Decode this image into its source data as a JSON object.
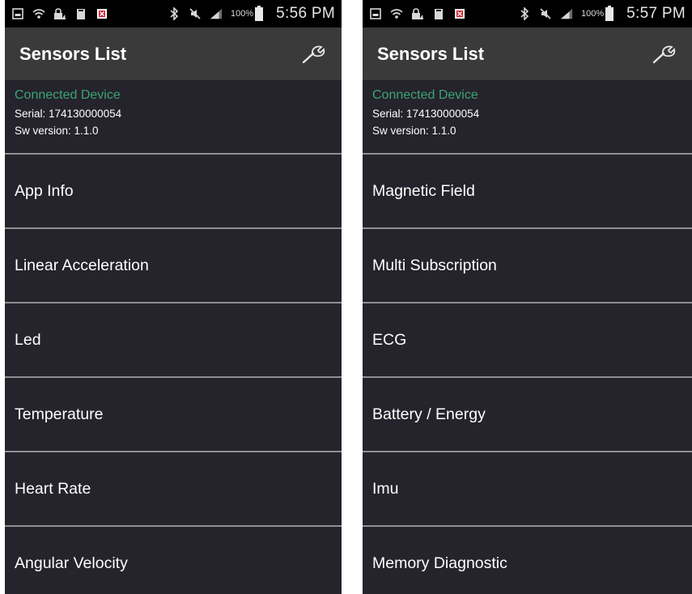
{
  "screens": [
    {
      "status": {
        "battery_pct": "100%",
        "time": "5:56 PM"
      },
      "header": {
        "title": "Sensors List",
        "settings_icon": "wrench-icon"
      },
      "device": {
        "connected_label": "Connected Device",
        "serial": "Serial: 174130000054",
        "sw_version": "Sw version: 1.1.0"
      },
      "items": [
        {
          "label": "App Info"
        },
        {
          "label": "Linear Acceleration"
        },
        {
          "label": "Led"
        },
        {
          "label": "Temperature"
        },
        {
          "label": "Heart Rate"
        },
        {
          "label": "Angular Velocity"
        }
      ]
    },
    {
      "status": {
        "battery_pct": "100%",
        "time": "5:57 PM"
      },
      "header": {
        "title": "Sensors List",
        "settings_icon": "wrench-icon"
      },
      "device": {
        "connected_label": "Connected Device",
        "serial": "Serial: 174130000054",
        "sw_version": "Sw version: 1.1.0"
      },
      "items": [
        {
          "label": "Magnetic Field"
        },
        {
          "label": "Multi Subscription"
        },
        {
          "label": "ECG"
        },
        {
          "label": "Battery / Energy"
        },
        {
          "label": "Imu"
        },
        {
          "label": "Memory Diagnostic"
        }
      ]
    }
  ],
  "colors": {
    "background": "#25232b",
    "action_bar": "#3a3a3b",
    "status_bar": "#000000",
    "connected_text": "#3aa574",
    "divider": "#8f8f93"
  }
}
